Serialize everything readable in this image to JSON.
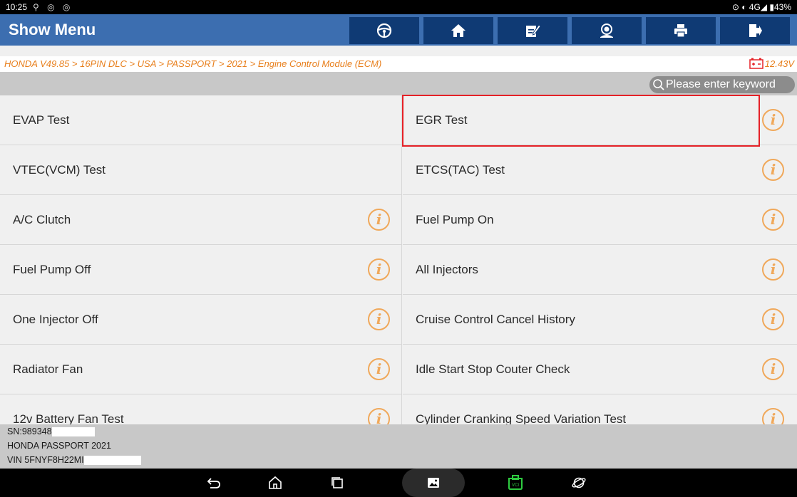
{
  "status_bar": {
    "time": "10:25",
    "left_icons": "⚲ ◎ ◎",
    "right_text": "⊙ ◐ 4G◢ ▮43%"
  },
  "header": {
    "title": "Show Menu",
    "buttons": [
      "steering-wheel-icon",
      "home-icon",
      "edit-report-icon",
      "remote-support-icon",
      "print-icon",
      "exit-icon"
    ]
  },
  "breadcrumb": {
    "path": "HONDA V49.85 > 16PIN DLC > USA > PASSPORT > 2021 > Engine Control Module (ECM)",
    "voltage": "12.43V"
  },
  "search": {
    "placeholder": "Please enter keyword"
  },
  "menu": {
    "left": [
      "EVAP Test",
      "VTEC(VCM) Test",
      "A/C Clutch",
      "Fuel Pump Off",
      "One Injector Off",
      "Radiator Fan",
      "12v Battery Fan Test"
    ],
    "right": [
      "EGR Test",
      "ETCS(TAC) Test",
      "Fuel Pump On",
      "All Injectors",
      "Cruise Control Cancel History",
      "Idle Start Stop Couter Check",
      "Cylinder Cranking Speed Variation Test"
    ],
    "info_glyph": "i"
  },
  "footer": {
    "sn": "SN:989348",
    "vehicle": "HONDA PASSPORT 2021",
    "vin": "VIN 5FNYF8H22MI"
  },
  "nav": [
    "back-icon",
    "home-outline-icon",
    "recents-icon",
    "gallery-icon",
    "vci-icon",
    "browser-icon"
  ],
  "colors": {
    "header": "#3c6eb0",
    "header_button": "#0f3a74",
    "accent_orange": "#e87f1c",
    "info_icon": "#f0a85a",
    "highlight": "#e52127",
    "vci_green": "#2ecc40"
  }
}
